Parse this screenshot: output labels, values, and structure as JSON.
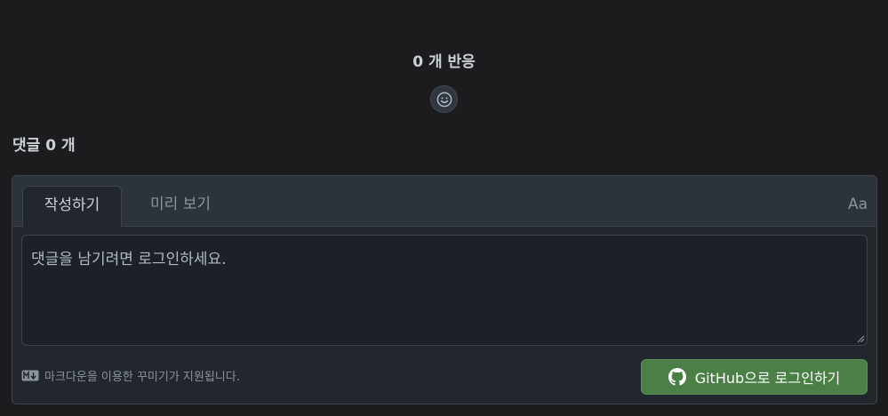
{
  "reactions": {
    "title": "0 개 반응",
    "add_reaction_icon": "smiley-face-icon"
  },
  "comments": {
    "count_label": "댓글 0 개"
  },
  "editor": {
    "tabs": [
      {
        "label": "작성하기",
        "active": true
      },
      {
        "label": "미리 보기",
        "active": false
      }
    ],
    "text_format_label": "Aa",
    "placeholder": "댓글을 남기려면 로그인하세요.",
    "markdown_note": "마크다운을 이용한 꾸미기가 지원됩니다.",
    "markdown_icon": "markdown-icon",
    "login_button": {
      "label": "GitHub으로 로그인하기",
      "icon": "github-icon",
      "color": "#4a7f46"
    }
  }
}
